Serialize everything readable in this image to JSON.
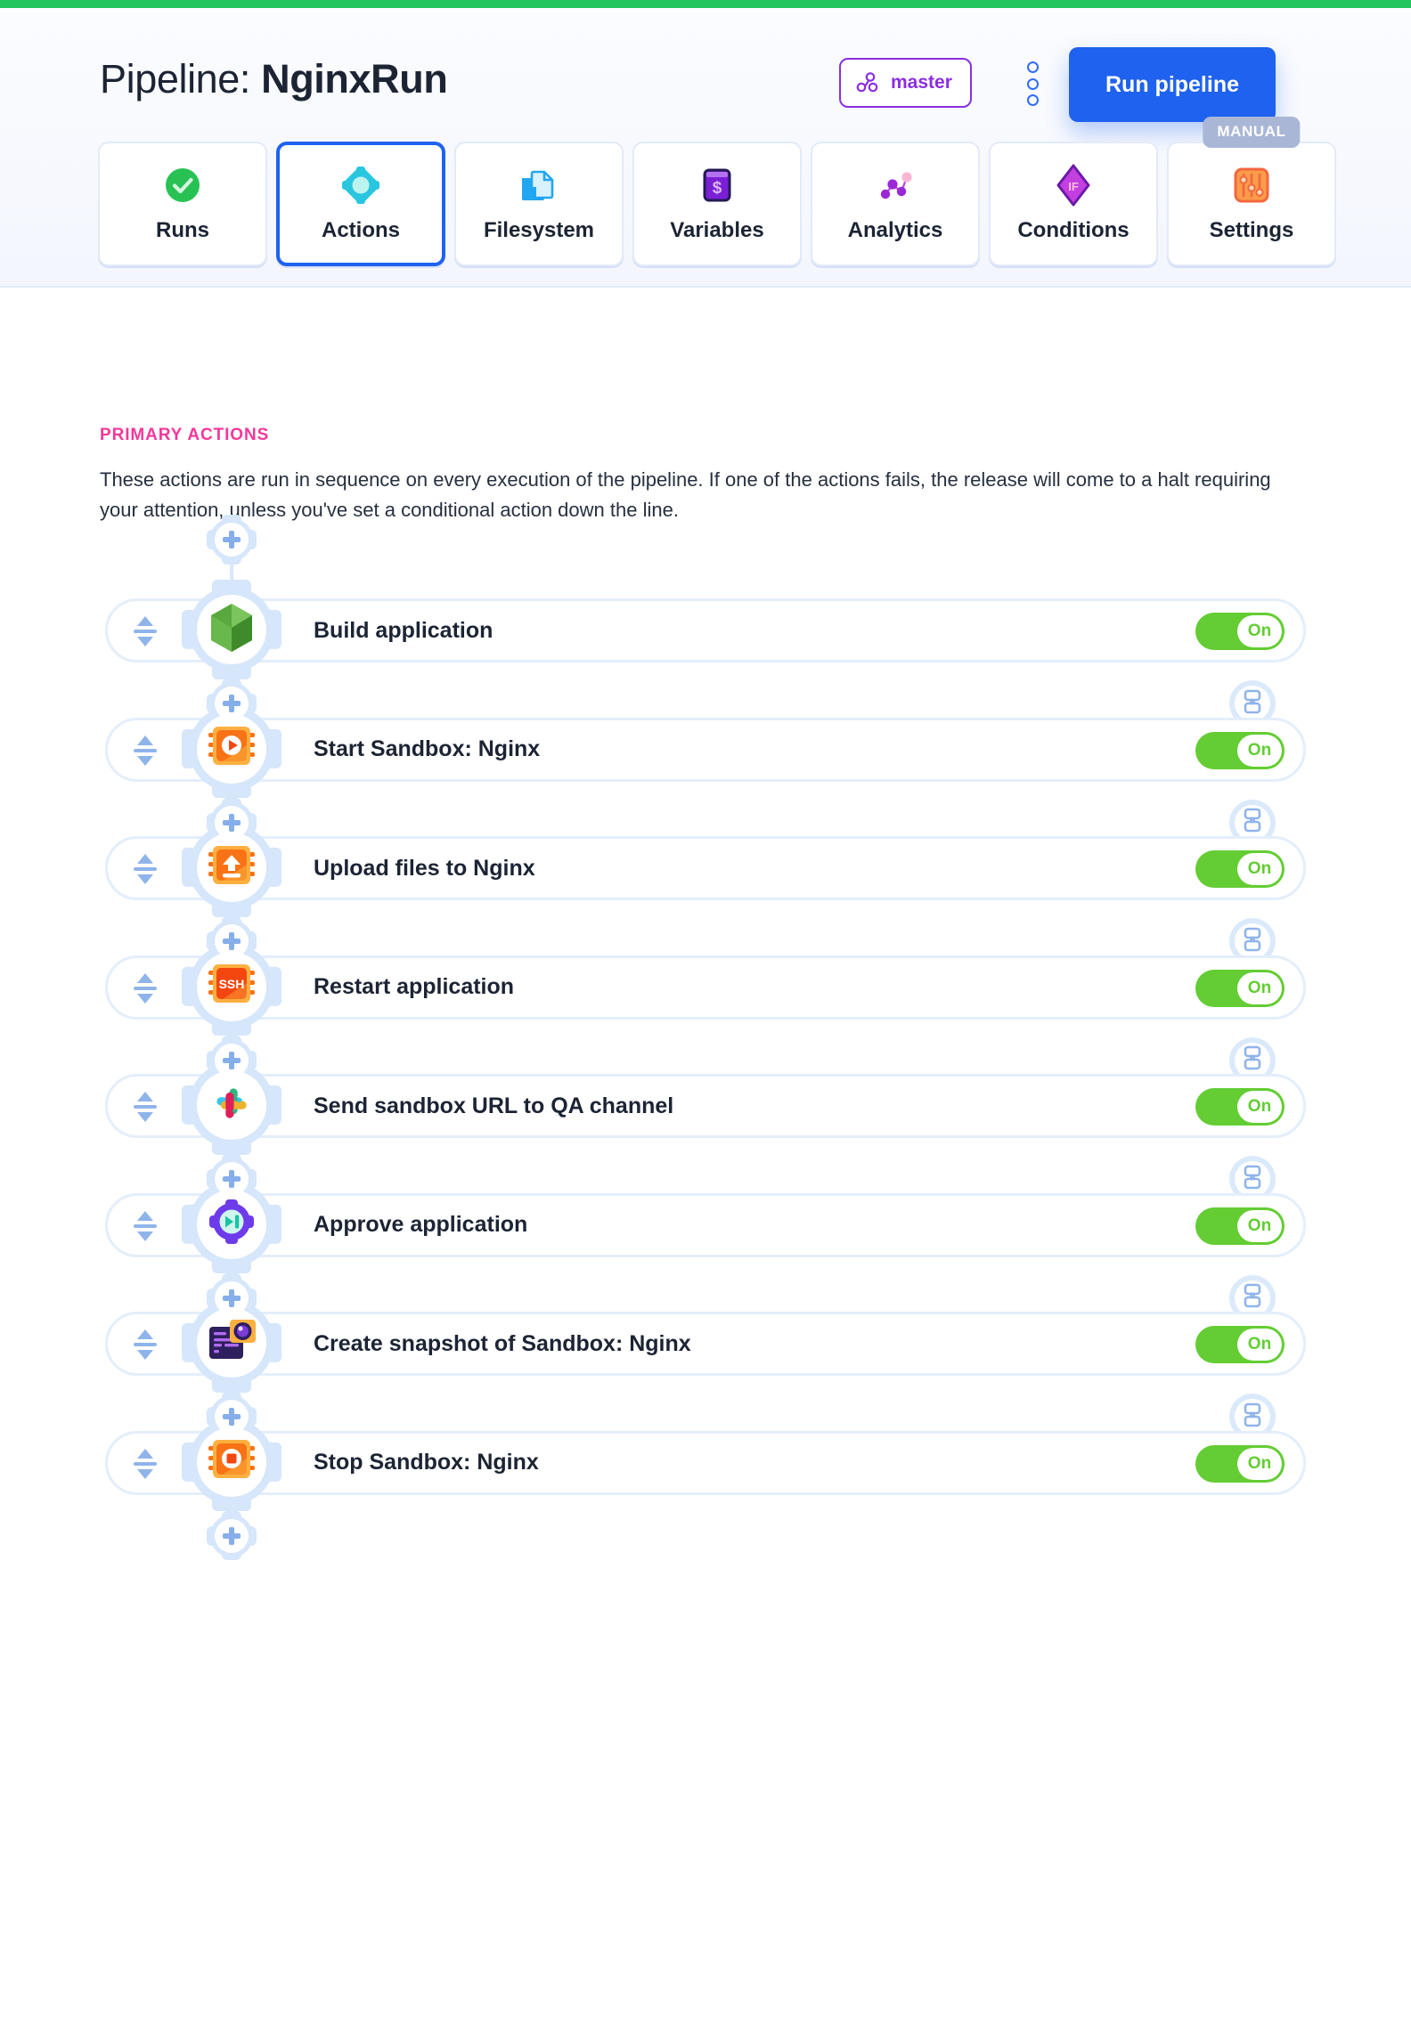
{
  "header": {
    "title_prefix": "Pipeline: ",
    "title_name": "NginxRun",
    "branch": "master",
    "branch_icon": "git-branch-icon",
    "kebab_icon": "more-options-icon",
    "run_button": "Run pipeline",
    "accent_blue": "#1f62f0",
    "accent_purple": "#8b2ee0",
    "top_bar_color": "#22c55e"
  },
  "tabs": [
    {
      "label": "Runs",
      "icon": "check-circle-icon",
      "active": false,
      "badge": ""
    },
    {
      "label": "Actions",
      "icon": "gear-icon",
      "active": true,
      "badge": ""
    },
    {
      "label": "Filesystem",
      "icon": "file-folder-icon",
      "active": false,
      "badge": ""
    },
    {
      "label": "Variables",
      "icon": "terminal-dollar-icon",
      "active": false,
      "badge": ""
    },
    {
      "label": "Analytics",
      "icon": "graph-nodes-icon",
      "active": false,
      "badge": ""
    },
    {
      "label": "Conditions",
      "icon": "diamond-if-icon",
      "active": false,
      "badge": ""
    },
    {
      "label": "Settings",
      "icon": "sliders-icon",
      "active": false,
      "badge": "MANUAL"
    }
  ],
  "section": {
    "title": "PRIMARY ACTIONS",
    "title_color": "#f4379a",
    "description": "These actions are run in sequence on every execution of the pipeline. If one of the actions fails, the release will come to a halt requiring your attention, unless you've set a conditional action down the line."
  },
  "actions": [
    {
      "name": "Build application",
      "icon": "nodejs-hexagon-icon",
      "toggle": "On",
      "enabled": true
    },
    {
      "name": "Start Sandbox: Nginx",
      "icon": "sandbox-play-icon",
      "toggle": "On",
      "enabled": true
    },
    {
      "name": "Upload files to Nginx",
      "icon": "sandbox-upload-icon",
      "toggle": "On",
      "enabled": true
    },
    {
      "name": "Restart application",
      "icon": "ssh-chip-icon",
      "toggle": "On",
      "enabled": true
    },
    {
      "name": "Send sandbox URL to QA channel",
      "icon": "slack-icon",
      "toggle": "On",
      "enabled": true
    },
    {
      "name": "Approve application",
      "icon": "approve-gear-play-icon",
      "toggle": "On",
      "enabled": true
    },
    {
      "name": "Create snapshot of Sandbox: Nginx",
      "icon": "snapshot-camera-icon",
      "toggle": "On",
      "enabled": true
    },
    {
      "name": "Stop Sandbox: Nginx",
      "icon": "sandbox-stop-icon",
      "toggle": "On",
      "enabled": true
    }
  ],
  "controls": {
    "add_action_icon": "plus-icon",
    "wait_icon": "hourglass-icon",
    "drag_handle_icon": "drag-updown-icon",
    "toggle_on_color": "#63cd33"
  }
}
